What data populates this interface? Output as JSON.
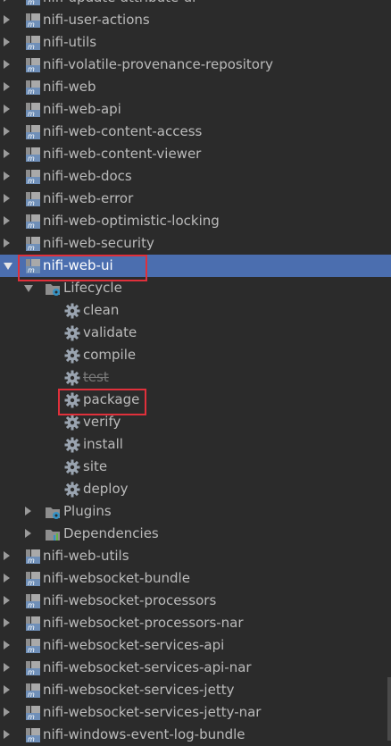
{
  "modules_top": [
    {
      "name": "nifi-update-attribute-ui"
    },
    {
      "name": "nifi-user-actions"
    },
    {
      "name": "nifi-utils"
    },
    {
      "name": "nifi-volatile-provenance-repository"
    },
    {
      "name": "nifi-web"
    },
    {
      "name": "nifi-web-api"
    },
    {
      "name": "nifi-web-content-access"
    },
    {
      "name": "nifi-web-content-viewer"
    },
    {
      "name": "nifi-web-docs"
    },
    {
      "name": "nifi-web-error"
    },
    {
      "name": "nifi-web-optimistic-locking"
    },
    {
      "name": "nifi-web-security"
    }
  ],
  "expanded_module": {
    "name": "nifi-web-ui",
    "lifecycle": {
      "label": "Lifecycle",
      "phases": [
        {
          "name": "clean",
          "skipped": false
        },
        {
          "name": "validate",
          "skipped": false
        },
        {
          "name": "compile",
          "skipped": false
        },
        {
          "name": "test",
          "skipped": true
        },
        {
          "name": "package",
          "skipped": false
        },
        {
          "name": "verify",
          "skipped": false
        },
        {
          "name": "install",
          "skipped": false
        },
        {
          "name": "site",
          "skipped": false
        },
        {
          "name": "deploy",
          "skipped": false
        }
      ]
    },
    "plugins_label": "Plugins",
    "dependencies_label": "Dependencies"
  },
  "modules_bottom": [
    {
      "name": "nifi-web-utils"
    },
    {
      "name": "nifi-websocket-bundle"
    },
    {
      "name": "nifi-websocket-processors"
    },
    {
      "name": "nifi-websocket-processors-nar"
    },
    {
      "name": "nifi-websocket-services-api"
    },
    {
      "name": "nifi-websocket-services-api-nar"
    },
    {
      "name": "nifi-websocket-services-jetty"
    },
    {
      "name": "nifi-websocket-services-jetty-nar"
    },
    {
      "name": "nifi-windows-event-log-bundle"
    }
  ],
  "highlight_color": "#e0303b",
  "selection_color": "#4b6eaf"
}
